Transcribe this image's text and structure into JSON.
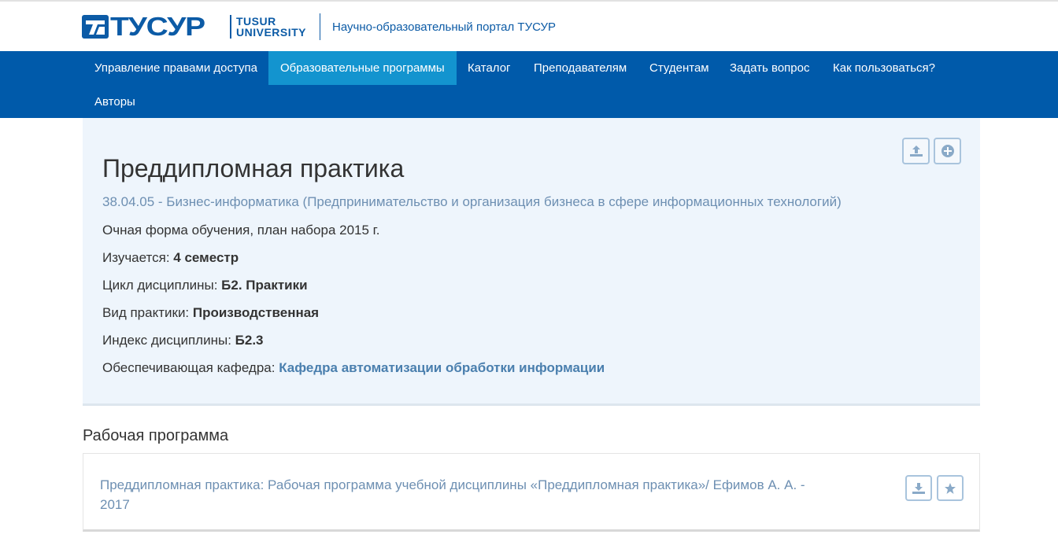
{
  "header": {
    "logo_word": "ТУСУР",
    "logo_uni_line1": "TUSUR",
    "logo_uni_line2": "UNIVERSITY",
    "portal_title": "Научно-образовательный портал ТУСУР"
  },
  "nav": {
    "items": [
      {
        "label": "Управление правами доступа"
      },
      {
        "label": "Образовательные программы",
        "active": true
      },
      {
        "label": "Каталог"
      },
      {
        "label": "Преподавателям"
      },
      {
        "label": "Студентам"
      },
      {
        "label": "Задать вопрос"
      },
      {
        "label": "Как пользоваться?"
      },
      {
        "label": "Авторы"
      }
    ]
  },
  "discipline": {
    "title": "Преддипломная практика",
    "program": "38.04.05 - Бизнес-информатика (Предпринимательство и организация бизнеса в сфере информационных технологий)",
    "form": "Очная форма обучения, план набора 2015 г.",
    "semester_label": "Изучается: ",
    "semester_value": "4 семестр",
    "cycle_label": "Цикл дисциплины: ",
    "cycle_value": "Б2. Практики",
    "practice_type_label": "Вид практики: ",
    "practice_type_value": "Производственная",
    "index_label": "Индекс дисциплины: ",
    "index_value": "Б2.3",
    "department_label": "Обеспечивающая кафедра: ",
    "department_value": "Кафедра автоматизации обработки информации"
  },
  "work_program": {
    "section_title": "Рабочая программа",
    "doc_title": "Преддипломная практика: Рабочая программа учебной дисциплины «Преддипломная практика»/ Ефимов А. А. - 2017"
  },
  "icons": {
    "upload": "upload-icon",
    "add": "plus-circle-icon",
    "download": "download-icon",
    "star": "star-icon"
  },
  "colors": {
    "brand": "#005aaa",
    "nav_active": "#1394cf",
    "panel_bg": "#eef5fc",
    "link": "#6d8fb2",
    "department_link": "#4a7fae",
    "button_border": "#a9c4dd"
  }
}
